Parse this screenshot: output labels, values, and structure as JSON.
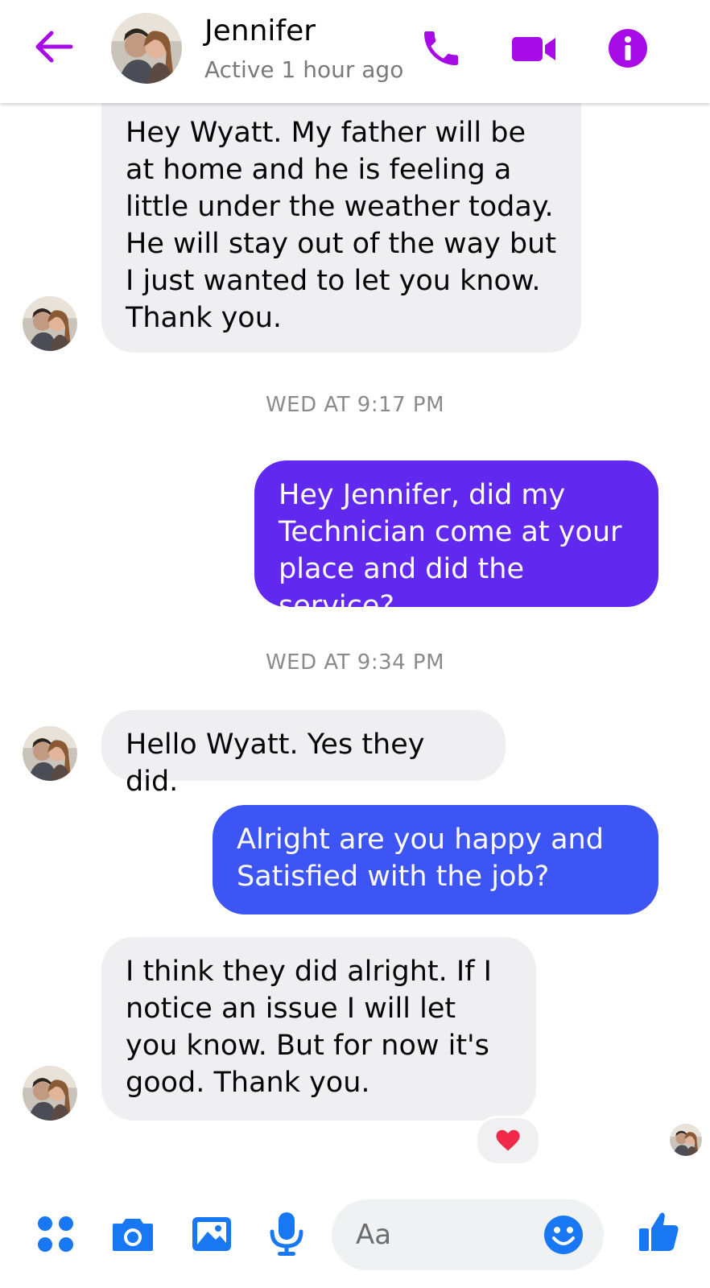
{
  "header": {
    "contact_name": "Jennifer",
    "status": "Active 1 hour ago"
  },
  "colors": {
    "accent_purple": "#a70ce6",
    "outgoing_purple": "#6128f0",
    "outgoing_blue": "#3d55f5",
    "incoming_bg": "#efeff1",
    "composer_blue": "#1877f2"
  },
  "icons": {
    "back": "arrow-left-icon",
    "call": "phone-icon",
    "video": "video-camera-icon",
    "info": "info-icon",
    "more": "four-dots-icon",
    "camera": "camera-icon",
    "gallery": "image-icon",
    "voice": "microphone-icon",
    "emoji": "smiley-icon",
    "like": "thumbs-up-icon",
    "reaction": "heart-icon"
  },
  "messages": [
    {
      "direction": "in",
      "text": "Hey Wyatt. My father will be at home and he is feeling a little under the weather today. He will stay out of the way but I just wanted to let you know. Thank you."
    },
    {
      "timestamp": "WED AT 9:17 PM"
    },
    {
      "direction": "out",
      "text": "Hey Jennifer, did my Technician come at your place and did the service?"
    },
    {
      "timestamp": "WED AT 9:34 PM"
    },
    {
      "direction": "in",
      "text": "Hello Wyatt. Yes they did."
    },
    {
      "direction": "out",
      "text": "Alright are you happy and Satisfied with the job?"
    },
    {
      "direction": "in",
      "text": "I think they did alright. If I notice an issue I will let you know. But for now it's good. Thank you.",
      "reaction": "heart"
    }
  ],
  "composer": {
    "placeholder": "Aa"
  }
}
